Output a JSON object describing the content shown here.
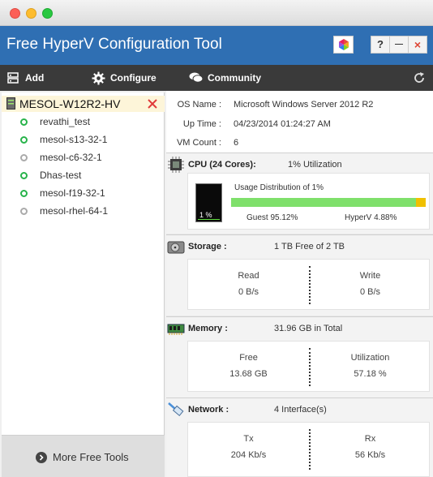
{
  "window": {
    "title": "Free HyperV Configuration Tool",
    "help_label": "?",
    "minimize_label": "—",
    "close_label": "×"
  },
  "colors": {
    "title_bar": "#2f6fb3",
    "toolbar": "#3a3a3a",
    "running": "#27b34a",
    "stopped": "#aaaaaa",
    "guest": "#7fe06b",
    "hyperv": "#f0c000"
  },
  "toolbar": {
    "add_server": "Add Server",
    "configure_vm": "Configure VM",
    "community": "Community"
  },
  "sidebar": {
    "server": "MESOL-W12R2-HV",
    "vms": [
      {
        "name": "revathi_test",
        "status": "running"
      },
      {
        "name": "mesol-s13-32-1",
        "status": "running"
      },
      {
        "name": "mesol-c6-32-1",
        "status": "stopped"
      },
      {
        "name": "Dhas-test",
        "status": "running"
      },
      {
        "name": "mesol-f19-32-1",
        "status": "running"
      },
      {
        "name": "mesol-rhel-64-1",
        "status": "stopped"
      }
    ],
    "more_tools": "More Free Tools"
  },
  "info": {
    "os_label": "OS Name :",
    "os_value": "Microsoft Windows Server 2012 R2",
    "uptime_label": "Up Time :",
    "uptime_value": "04/23/2014 01:24:27 AM",
    "vmcount_label": "VM Count :",
    "vmcount_value": "6"
  },
  "cpu": {
    "heading": "CPU (24 Cores):",
    "utilization": "1% Utilization",
    "meter_label": "1 %",
    "usage_title": "Usage Distribution of 1%",
    "guest_label": "Guest 95.12%",
    "hyperv_label": "HyperV 4.88%",
    "guest_fraction": 0.9512,
    "hyperv_fraction": 0.0488
  },
  "storage": {
    "heading": "Storage :",
    "summary": "1  TB Free of 2  TB",
    "read_label": "Read",
    "read_value": "0 B/s",
    "write_label": "Write",
    "write_value": "0 B/s"
  },
  "memory": {
    "heading": "Memory :",
    "summary": "31.96  GB in Total",
    "free_label": "Free",
    "free_value": "13.68  GB",
    "util_label": "Utilization",
    "util_value": "57.18 %"
  },
  "network": {
    "heading": "Network :",
    "summary": "4 Interface(s)",
    "tx_label": "Tx",
    "tx_value": "204 Kb/s",
    "rx_label": "Rx",
    "rx_value": "56 Kb/s"
  }
}
